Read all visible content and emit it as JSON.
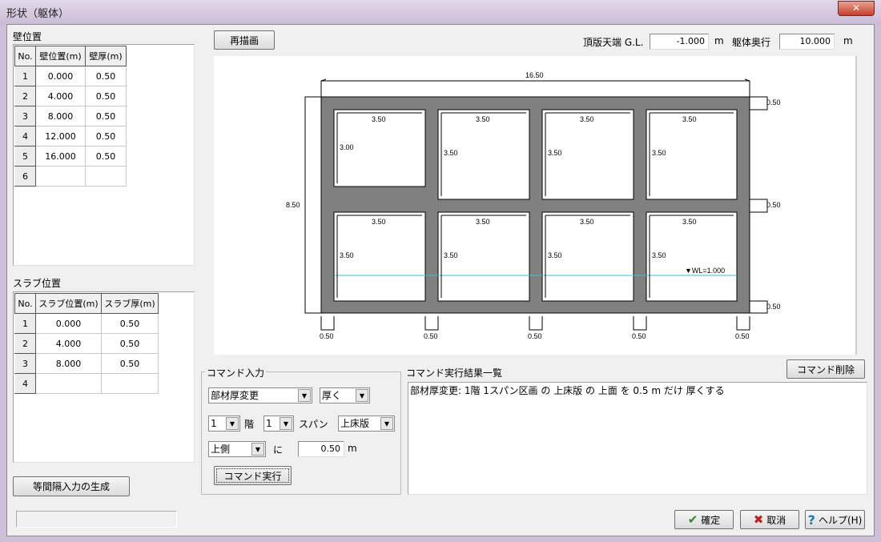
{
  "window": {
    "title": "形状（躯体）",
    "close": "✕"
  },
  "walls": {
    "label": "壁位置",
    "headers": [
      "No.",
      "壁位置(m)",
      "壁厚(m)"
    ],
    "rows": [
      [
        "1",
        "0.000",
        "0.50"
      ],
      [
        "2",
        "4.000",
        "0.50"
      ],
      [
        "3",
        "8.000",
        "0.50"
      ],
      [
        "4",
        "12.000",
        "0.50"
      ],
      [
        "5",
        "16.000",
        "0.50"
      ],
      [
        "6",
        "",
        ""
      ]
    ]
  },
  "slabs": {
    "label": "スラブ位置",
    "headers": [
      "No.",
      "スラブ位置(m)",
      "スラブ厚(m)"
    ],
    "rows": [
      [
        "1",
        "0.000",
        "0.50"
      ],
      [
        "2",
        "4.000",
        "0.50"
      ],
      [
        "3",
        "8.000",
        "0.50"
      ],
      [
        "4",
        "",
        ""
      ]
    ]
  },
  "gen_button": "等間隔入力の生成",
  "redraw_button": "再描画",
  "top_gl": {
    "label": "頂版天端 G.L.",
    "value": "-1.000",
    "unit": "m"
  },
  "depth": {
    "label": "躯体奥行",
    "value": "10.000",
    "unit": "m"
  },
  "drawing": {
    "width": "16.50",
    "height": "8.50",
    "span": "3.50",
    "cell1_height": "3.00",
    "thickness": "0.50",
    "water_level": "▼WL=1.000",
    "colors": {
      "concrete": "#808080",
      "water": "#3cc0d0"
    }
  },
  "command_delete": "コマンド削除",
  "command_input": {
    "legend": "コマンド入力",
    "operation": "部材厚変更",
    "direction": "厚く",
    "floor": "1",
    "floor_label": "階",
    "span": "1",
    "span_label": "スパン",
    "member": "上床版",
    "side": "上側",
    "ni": "に",
    "amount": "0.50",
    "unit": "m",
    "execute": "コマンド実行"
  },
  "results": {
    "label": "コマンド実行結果一覧",
    "lines": [
      "部材厚変更: 1階 1スパン区画 の 上床版 の 上面 を 0.5 m だけ 厚くする"
    ]
  },
  "footer": {
    "ok": "確定",
    "cancel": "取消",
    "help": "ヘルプ(H)"
  }
}
